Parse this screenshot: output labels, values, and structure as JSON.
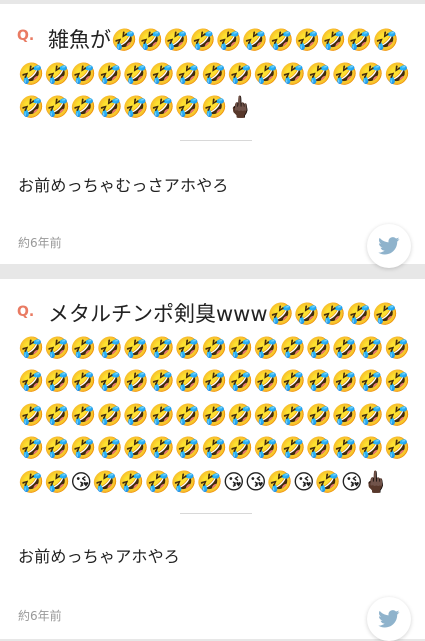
{
  "cards": [
    {
      "q_label": "Q.",
      "question": "雑魚が🤣🤣🤣🤣🤣🤣🤣🤣🤣🤣🤣🤣🤣🤣🤣🤣🤣🤣🤣🤣🤣🤣🤣🤣🤣🤣🤣🤣🤣🤣🤣🤣🤣🤣🖕🏿",
      "answer": "お前めっちゃむっさアホやろ",
      "time": "約6年前",
      "share_icon": "twitter-icon"
    },
    {
      "q_label": "Q.",
      "question": "メタルチンポ剣臭www🤣🤣🤣🤣🤣🤣🤣🤣🤣🤣🤣🤣🤣🤣🤣🤣🤣🤣🤣🤣🤣🤣🤣🤣🤣🤣🤣🤣🤣🤣🤣🤣🤣🤣🤣🤣🤣🤣🤣🤣🤣🤣🤣🤣🤣🤣🤣🤣🤣🤣🤣🤣🤣🤣🤣🤣🤣🤣🤣🤣🤣🤣🤣🤣🤣🤣🤣😘🤣🤣🤣🤣🤣😘😘🤣😘🤣😘🖕🏿",
      "answer": "お前めっちゃアホやろ",
      "time": "約6年前",
      "share_icon": "twitter-icon"
    }
  ],
  "colors": {
    "q_accent": "#e97b63",
    "twitter_blue": "#8fb3cc",
    "background": "#e7e7e7",
    "card": "#ffffff"
  }
}
